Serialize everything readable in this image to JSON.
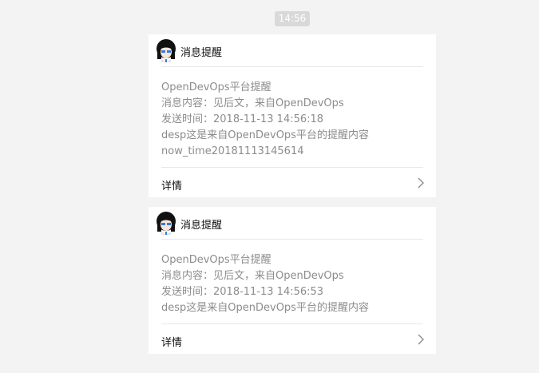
{
  "timestamp": "14:56",
  "messages": [
    {
      "sender": "消息提醒",
      "avatar_icon": "user-avatar-icon",
      "lines": [
        "OpenDevOps平台提醒",
        "消息内容：见后文，来自OpenDevOps",
        "发送时间：2018-11-13 14:56:18",
        "desp这是来自OpenDevOps平台的提醒内容",
        "now_time20181113145614"
      ],
      "details_label": "详情",
      "details_icon": "chevron-right-icon"
    },
    {
      "sender": "消息提醒",
      "avatar_icon": "user-avatar-icon",
      "lines": [
        "OpenDevOps平台提醒",
        "消息内容：见后文，来自OpenDevOps",
        "发送时间：2018-11-13 14:56:53",
        "desp这是来自OpenDevOps平台的提醒内容"
      ],
      "details_label": "详情",
      "details_icon": "chevron-right-icon"
    }
  ],
  "colors": {
    "background": "#f3f3f3",
    "card": "#ffffff",
    "body_text": "#8c8c8c",
    "title_text": "#111111",
    "divider": "#e8e8e8",
    "timestamp_pill": "#d9d9d9"
  }
}
